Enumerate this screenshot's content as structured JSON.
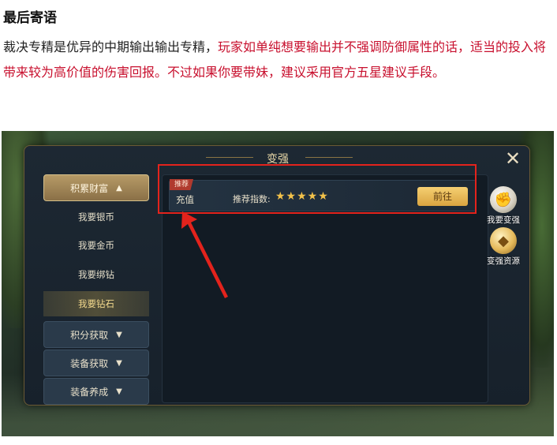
{
  "article": {
    "heading": "最后寄语",
    "para_part1": "裁决专精是优异的中期输出输出专精，",
    "para_part2": "玩家如单纯想要输出并不强调防御属性的话，适当的投入将带来较为高价值的伤害回报。不过如果你要带妹，建议采用官方五星建议手段。"
  },
  "game": {
    "panel_title": "变强",
    "close_icon": "close-x-icon",
    "categories": [
      {
        "label": "积累财富",
        "state": "expanded"
      },
      {
        "label": "积分获取",
        "state": "collapsed"
      },
      {
        "label": "装备获取",
        "state": "collapsed"
      },
      {
        "label": "装备养成",
        "state": "collapsed"
      }
    ],
    "sub_items": [
      "我要银币",
      "我要金币",
      "我要绑钻",
      "我要钻石"
    ],
    "selected_sub": "我要钻石",
    "recommendation": {
      "tag": "推荐",
      "name": "充值",
      "score_label": "推荐指数:",
      "stars": "★★★★★",
      "star_count": 5,
      "go_label": "前往"
    },
    "side_buttons": [
      {
        "label": "我要变强",
        "icon": "fist-icon"
      },
      {
        "label": "变强资源",
        "icon": "treasure-icon"
      }
    ],
    "highlight_color": "#e3231c"
  }
}
